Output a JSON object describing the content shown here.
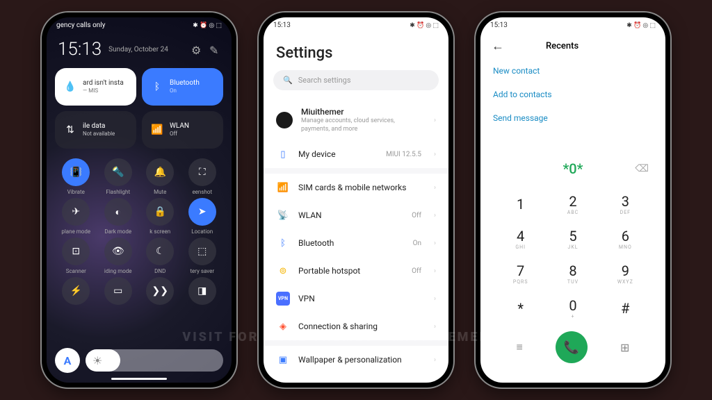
{
  "watermark": "VISIT FOR MORE THEMES - MIUITHEMER.COM",
  "status": {
    "time": "15:13",
    "carrier": "gency calls only",
    "icons": "✱ ⏰ ◎ ⬚"
  },
  "cc": {
    "time": "15:13",
    "date": "Sunday, October 24",
    "tiles": [
      {
        "label": "ard isn't insta",
        "sub": "— MIS"
      },
      {
        "label": "Bluetooth",
        "sub": "On"
      },
      {
        "label": "ile data",
        "sub": "Not available"
      },
      {
        "label": "WLAN",
        "sub": "Off"
      }
    ],
    "qs": [
      {
        "l": "Vibrate",
        "on": true,
        "g": "📳"
      },
      {
        "l": "Flashlight",
        "on": false,
        "g": "🔦"
      },
      {
        "l": "Mute",
        "on": false,
        "g": "🔔"
      },
      {
        "l": "eenshot",
        "on": false,
        "g": "⛶"
      },
      {
        "l": "plane mode",
        "on": false,
        "g": "✈"
      },
      {
        "l": "Dark mode",
        "on": false,
        "g": "◐"
      },
      {
        "l": "k screen",
        "on": false,
        "g": "🔒"
      },
      {
        "l": "Location",
        "on": true,
        "g": "➤"
      },
      {
        "l": "Scanner",
        "on": false,
        "g": "⊡"
      },
      {
        "l": "iding mode",
        "on": false,
        "g": "👁"
      },
      {
        "l": "DND",
        "on": false,
        "g": "☾"
      },
      {
        "l": "tery saver",
        "on": false,
        "g": "⬚"
      },
      {
        "l": "",
        "on": false,
        "g": "⚡"
      },
      {
        "l": "",
        "on": false,
        "g": "▭"
      },
      {
        "l": "",
        "on": false,
        "g": "❯❯"
      },
      {
        "l": "",
        "on": false,
        "g": "◨"
      }
    ],
    "auto": "A"
  },
  "settings": {
    "title": "Settings",
    "search": "Search settings",
    "account": {
      "name": "Miuithemer",
      "desc": "Manage accounts, cloud services, payments, and more"
    },
    "mydevice": {
      "label": "My device",
      "val": "MIUI 12.5.5"
    },
    "items": [
      {
        "ic": "📶",
        "c": "#f5b400",
        "l": "SIM cards & mobile networks",
        "v": ""
      },
      {
        "ic": "📡",
        "c": "#3b7bff",
        "l": "WLAN",
        "v": "Off"
      },
      {
        "ic": "ᛒ",
        "c": "#3b7bff",
        "l": "Bluetooth",
        "v": "On"
      },
      {
        "ic": "⊚",
        "c": "#f5b400",
        "l": "Portable hotspot",
        "v": "Off"
      },
      {
        "ic": "VPN",
        "c": "#4a6fff",
        "l": "VPN",
        "v": ""
      },
      {
        "ic": "◈",
        "c": "#ff5030",
        "l": "Connection & sharing",
        "v": ""
      }
    ],
    "wallpaper": {
      "ic": "▣",
      "c": "#3b7bff",
      "l": "Wallpaper & personalization"
    }
  },
  "dialer": {
    "title": "Recents",
    "links": [
      "New contact",
      "Add to contacts",
      "Send message"
    ],
    "number": "*0*",
    "keys": [
      {
        "n": "1",
        "l": ""
      },
      {
        "n": "2",
        "l": "ABC"
      },
      {
        "n": "3",
        "l": "DEF"
      },
      {
        "n": "4",
        "l": "GHI"
      },
      {
        "n": "5",
        "l": "JKL"
      },
      {
        "n": "6",
        "l": "MNO"
      },
      {
        "n": "7",
        "l": "PQRS"
      },
      {
        "n": "8",
        "l": "TUV"
      },
      {
        "n": "9",
        "l": "WXYZ"
      },
      {
        "n": "*",
        "l": ""
      },
      {
        "n": "0",
        "l": "+"
      },
      {
        "n": "#",
        "l": ""
      }
    ]
  }
}
